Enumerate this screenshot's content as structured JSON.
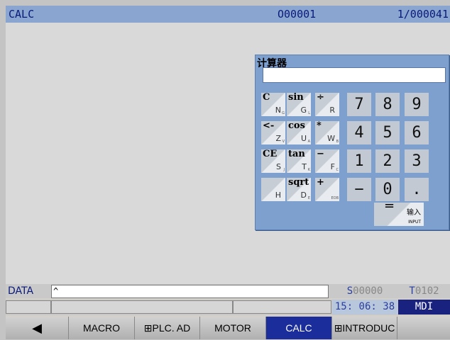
{
  "title": {
    "left": "CALC",
    "program": "O00001",
    "count": "1/000041"
  },
  "calculator": {
    "title": "计算器",
    "keys": [
      {
        "main": "C",
        "alt": "N",
        "sub": "G"
      },
      {
        "main": "sin",
        "alt": "G",
        "sub": "L"
      },
      {
        "main": "÷",
        "alt": "R",
        "sub": ""
      },
      {
        "main": "7"
      },
      {
        "main": "8"
      },
      {
        "main": "9"
      },
      {
        "main": "<-",
        "alt": "Z",
        "sub": "V"
      },
      {
        "main": "cos",
        "alt": "U",
        "sub": "A"
      },
      {
        "main": "*",
        "alt": "W",
        "sub": "B"
      },
      {
        "main": "4"
      },
      {
        "main": "5"
      },
      {
        "main": "6"
      },
      {
        "main": "CE",
        "alt": "S",
        "sub": "J"
      },
      {
        "main": "tan",
        "alt": "T",
        "sub": "K"
      },
      {
        "main": "−",
        "alt": "F",
        "sub": "C"
      },
      {
        "main": "1"
      },
      {
        "main": "2"
      },
      {
        "main": "3"
      },
      {
        "main": "",
        "alt": "H",
        "sub": ""
      },
      {
        "main": "sqrt",
        "alt": "D",
        "sub": "E"
      },
      {
        "main": "+",
        "alt": "",
        "sub": "EOB"
      },
      {
        "main": "−"
      },
      {
        "main": "0"
      },
      {
        "main": "."
      }
    ],
    "equals": {
      "main": "=",
      "label": "输入",
      "sub": "INPUT"
    }
  },
  "data": {
    "label": "DATA",
    "input": "^",
    "s_prefix": "S",
    "s_value": "00000",
    "t_prefix": "T",
    "t_value": "0102"
  },
  "status": {
    "time": "15: 06: 38",
    "mode": "MDI"
  },
  "softkeys": [
    "◀",
    "MACRO",
    "⊞PLC. AD",
    "MOTOR",
    "CALC",
    "⊞INTRODUC",
    ""
  ]
}
